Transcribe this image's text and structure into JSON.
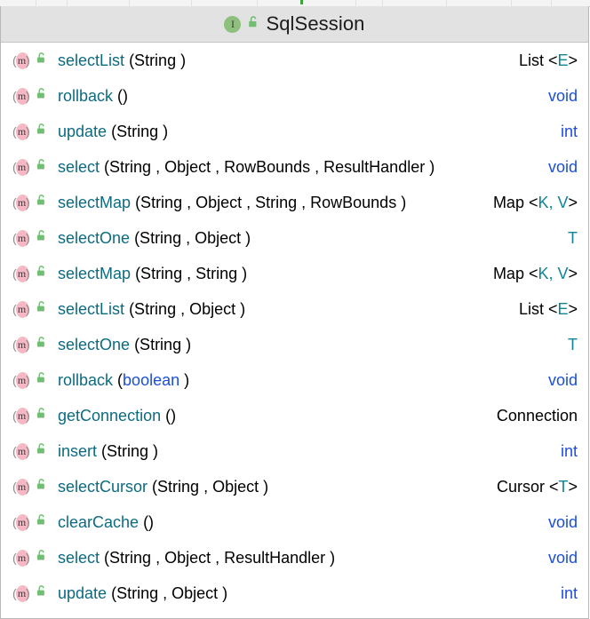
{
  "popup": {
    "header": {
      "title": "SqlSession",
      "type_icon": "interface-icon",
      "type_icon_letter": "I",
      "visibility_icon": "unlock-icon"
    },
    "columns": [
      "member",
      "return_type"
    ],
    "methods": [
      {
        "icon": "method-icon",
        "visibility": "unlock-icon",
        "name": "selectList",
        "params": "(String )",
        "return_plain": "List <E>",
        "return_base": "List",
        "generic_open": " <",
        "generic_args": "E",
        "generic_close": ">",
        "return_is_keyword": false
      },
      {
        "icon": "method-icon",
        "visibility": "unlock-icon",
        "name": "rollback",
        "params": "()",
        "return_plain": "void",
        "return_base": "void",
        "generic_open": "",
        "generic_args": "",
        "generic_close": "",
        "return_is_keyword": true
      },
      {
        "icon": "method-icon",
        "visibility": "unlock-icon",
        "name": "update",
        "params": "(String )",
        "return_plain": "int",
        "return_base": "int",
        "generic_open": "",
        "generic_args": "",
        "generic_close": "",
        "return_is_keyword": true
      },
      {
        "icon": "method-icon",
        "visibility": "unlock-icon",
        "name": "select",
        "params": "(String , Object , RowBounds , ResultHandler )",
        "return_plain": "void",
        "return_base": "void",
        "generic_open": "",
        "generic_args": "",
        "generic_close": "",
        "return_is_keyword": true
      },
      {
        "icon": "method-icon",
        "visibility": "unlock-icon",
        "name": "selectMap",
        "params": "(String , Object , String , RowBounds )",
        "return_plain": "Map <K, V>",
        "return_base": "Map",
        "generic_open": " <",
        "generic_args": "K, V",
        "generic_close": ">",
        "return_is_keyword": false
      },
      {
        "icon": "method-icon",
        "visibility": "unlock-icon",
        "name": "selectOne",
        "params": "(String , Object )",
        "return_plain": "T",
        "return_base": "",
        "generic_open": "",
        "generic_args": "T",
        "generic_close": "",
        "return_is_keyword": false
      },
      {
        "icon": "method-icon",
        "visibility": "unlock-icon",
        "name": "selectMap",
        "params": "(String , String )",
        "return_plain": "Map <K, V>",
        "return_base": "Map",
        "generic_open": " <",
        "generic_args": "K, V",
        "generic_close": ">",
        "return_is_keyword": false
      },
      {
        "icon": "method-icon",
        "visibility": "unlock-icon",
        "name": "selectList",
        "params": "(String , Object )",
        "return_plain": "List <E>",
        "return_base": "List",
        "generic_open": " <",
        "generic_args": "E",
        "generic_close": ">",
        "return_is_keyword": false
      },
      {
        "icon": "method-icon",
        "visibility": "unlock-icon",
        "name": "selectOne",
        "params": "(String )",
        "return_plain": "T",
        "return_base": "",
        "generic_open": "",
        "generic_args": "T",
        "generic_close": "",
        "return_is_keyword": false
      },
      {
        "icon": "method-icon",
        "visibility": "unlock-icon",
        "name": "rollback",
        "params": "(boolean )",
        "return_plain": "void",
        "return_base": "void",
        "generic_open": "",
        "generic_args": "",
        "generic_close": "",
        "return_is_keyword": true,
        "param_keyword": "boolean"
      },
      {
        "icon": "method-icon",
        "visibility": "unlock-icon",
        "name": "getConnection",
        "params": "()",
        "return_plain": "Connection",
        "return_base": "Connection",
        "generic_open": "",
        "generic_args": "",
        "generic_close": "",
        "return_is_keyword": false
      },
      {
        "icon": "method-icon",
        "visibility": "unlock-icon",
        "name": "insert",
        "params": "(String )",
        "return_plain": "int",
        "return_base": "int",
        "generic_open": "",
        "generic_args": "",
        "generic_close": "",
        "return_is_keyword": true
      },
      {
        "icon": "method-icon",
        "visibility": "unlock-icon",
        "name": "selectCursor",
        "params": "(String , Object )",
        "return_plain": "Cursor <T>",
        "return_base": "Cursor",
        "generic_open": " <",
        "generic_args": "T",
        "generic_close": ">",
        "return_is_keyword": false
      },
      {
        "icon": "method-icon",
        "visibility": "unlock-icon",
        "name": "clearCache",
        "params": "()",
        "return_plain": "void",
        "return_base": "void",
        "generic_open": "",
        "generic_args": "",
        "generic_close": "",
        "return_is_keyword": true
      },
      {
        "icon": "method-icon",
        "visibility": "unlock-icon",
        "name": "select",
        "params": "(String , Object , ResultHandler )",
        "return_plain": "void",
        "return_base": "void",
        "generic_open": "",
        "generic_args": "",
        "generic_close": "",
        "return_is_keyword": true
      },
      {
        "icon": "method-icon",
        "visibility": "unlock-icon",
        "name": "update",
        "params": "(String , Object )",
        "return_plain": "int",
        "return_base": "int",
        "generic_open": "",
        "generic_args": "",
        "generic_close": "",
        "return_is_keyword": true
      }
    ]
  },
  "colors": {
    "header_bg": "#e2e2e2",
    "method_name": "#0d6b80",
    "keyword": "#1d4ede",
    "type_param": "#0f8494",
    "method_icon": "#f5b8c4",
    "visibility_icon": "#71bd71",
    "interface_icon": "#8cc07c"
  }
}
